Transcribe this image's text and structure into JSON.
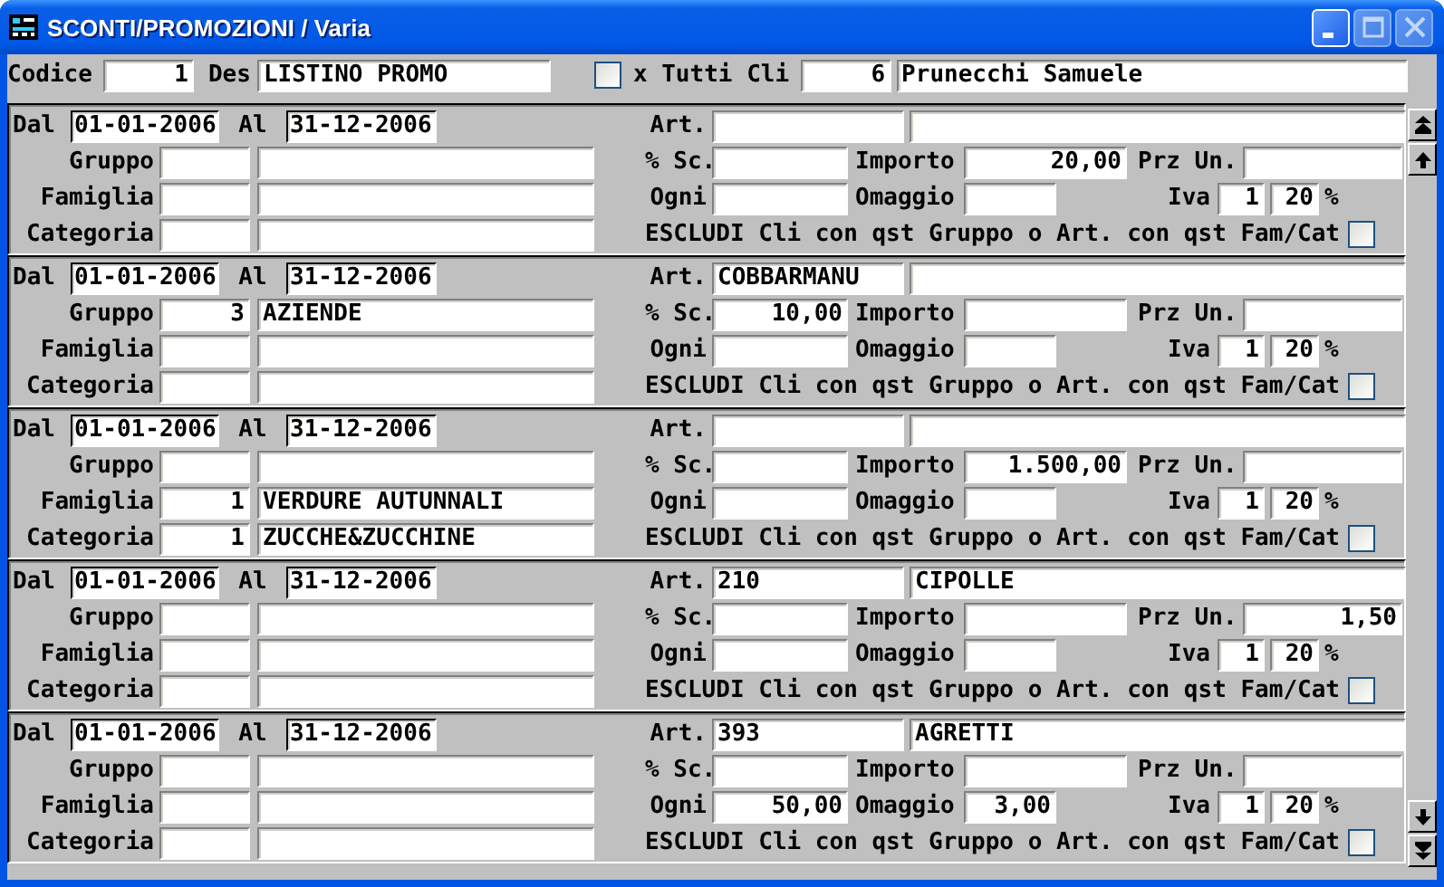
{
  "window": {
    "title": "SCONTI/PROMOZIONI / Varia",
    "controls": [
      {
        "kind": "minimize",
        "disabled": false
      },
      {
        "kind": "maximize",
        "disabled": true
      },
      {
        "kind": "close",
        "disabled": true
      }
    ]
  },
  "header": {
    "codice_label": "Codice",
    "codice": "1",
    "des_label": "Des",
    "des": "LISTINO PROMO",
    "tutti_cli_checked": false,
    "tutti_cli_label": "x Tutti Cli",
    "cli_code": "6",
    "cli_name": "Prunecchi Samuele"
  },
  "records": [
    {
      "labels": {
        "dal": "Dal",
        "al": "Al",
        "art": "Art.",
        "gruppo": "Gruppo",
        "sconto": "% Sc.",
        "importo": "Importo",
        "prz_un": "Prz Un.",
        "famiglia": "Famiglia",
        "ogni": "Ogni",
        "omaggio": "Omaggio",
        "iva": "Iva",
        "percent": "%",
        "categoria": "Categoria",
        "escludi": "ESCLUDI Cli con qst Gruppo o Art. con qst Fam/Cat"
      },
      "dal": "01-01-2006",
      "al": "31-12-2006",
      "importo": "20,00",
      "iva_code": "1",
      "iva_rate": "20",
      "escludi_checked": false
    },
    {
      "labels": {
        "dal": "Dal",
        "al": "Al",
        "art": "Art.",
        "gruppo": "Gruppo",
        "sconto": "% Sc.",
        "importo": "Importo",
        "prz_un": "Prz Un.",
        "famiglia": "Famiglia",
        "ogni": "Ogni",
        "omaggio": "Omaggio",
        "iva": "Iva",
        "percent": "%",
        "categoria": "Categoria",
        "escludi": "ESCLUDI Cli con qst Gruppo o Art. con qst Fam/Cat"
      },
      "dal": "01-01-2006",
      "al": "31-12-2006",
      "art_code": "COBBARMANU",
      "gruppo_code": "3",
      "gruppo_name": "AZIENDE",
      "sconto": "10,00",
      "iva_code": "1",
      "iva_rate": "20",
      "escludi_checked": false
    },
    {
      "labels": {
        "dal": "Dal",
        "al": "Al",
        "art": "Art.",
        "gruppo": "Gruppo",
        "sconto": "% Sc.",
        "importo": "Importo",
        "prz_un": "Prz Un.",
        "famiglia": "Famiglia",
        "ogni": "Ogni",
        "omaggio": "Omaggio",
        "iva": "Iva",
        "percent": "%",
        "categoria": "Categoria",
        "escludi": "ESCLUDI Cli con qst Gruppo o Art. con qst Fam/Cat"
      },
      "dal": "01-01-2006",
      "al": "31-12-2006",
      "famiglia_code": "1",
      "famiglia_name": "VERDURE AUTUNNALI",
      "categoria_code": "1",
      "categoria_name": "ZUCCHE&ZUCCHINE",
      "importo": "1.500,00",
      "iva_code": "1",
      "iva_rate": "20",
      "escludi_checked": false
    },
    {
      "labels": {
        "dal": "Dal",
        "al": "Al",
        "art": "Art.",
        "gruppo": "Gruppo",
        "sconto": "% Sc.",
        "importo": "Importo",
        "prz_un": "Prz Un.",
        "famiglia": "Famiglia",
        "ogni": "Ogni",
        "omaggio": "Omaggio",
        "iva": "Iva",
        "percent": "%",
        "categoria": "Categoria",
        "escludi": "ESCLUDI Cli con qst Gruppo o Art. con qst Fam/Cat"
      },
      "dal": "01-01-2006",
      "al": "31-12-2006",
      "art_code": "210",
      "art_name": "CIPOLLE",
      "prz_un": "1,50",
      "iva_code": "1",
      "iva_rate": "20",
      "escludi_checked": false
    },
    {
      "labels": {
        "dal": "Dal",
        "al": "Al",
        "art": "Art.",
        "gruppo": "Gruppo",
        "sconto": "% Sc.",
        "importo": "Importo",
        "prz_un": "Prz Un.",
        "famiglia": "Famiglia",
        "ogni": "Ogni",
        "omaggio": "Omaggio",
        "iva": "Iva",
        "percent": "%",
        "categoria": "Categoria",
        "escludi": "ESCLUDI Cli con qst Gruppo o Art. con qst Fam/Cat"
      },
      "dal": "01-01-2006",
      "al": "31-12-2006",
      "art_code": "393",
      "art_name": "AGRETTI",
      "ogni": "50,00",
      "omaggio": "3,00",
      "iva_code": "1",
      "iva_rate": "20",
      "escludi_checked": false
    }
  ]
}
